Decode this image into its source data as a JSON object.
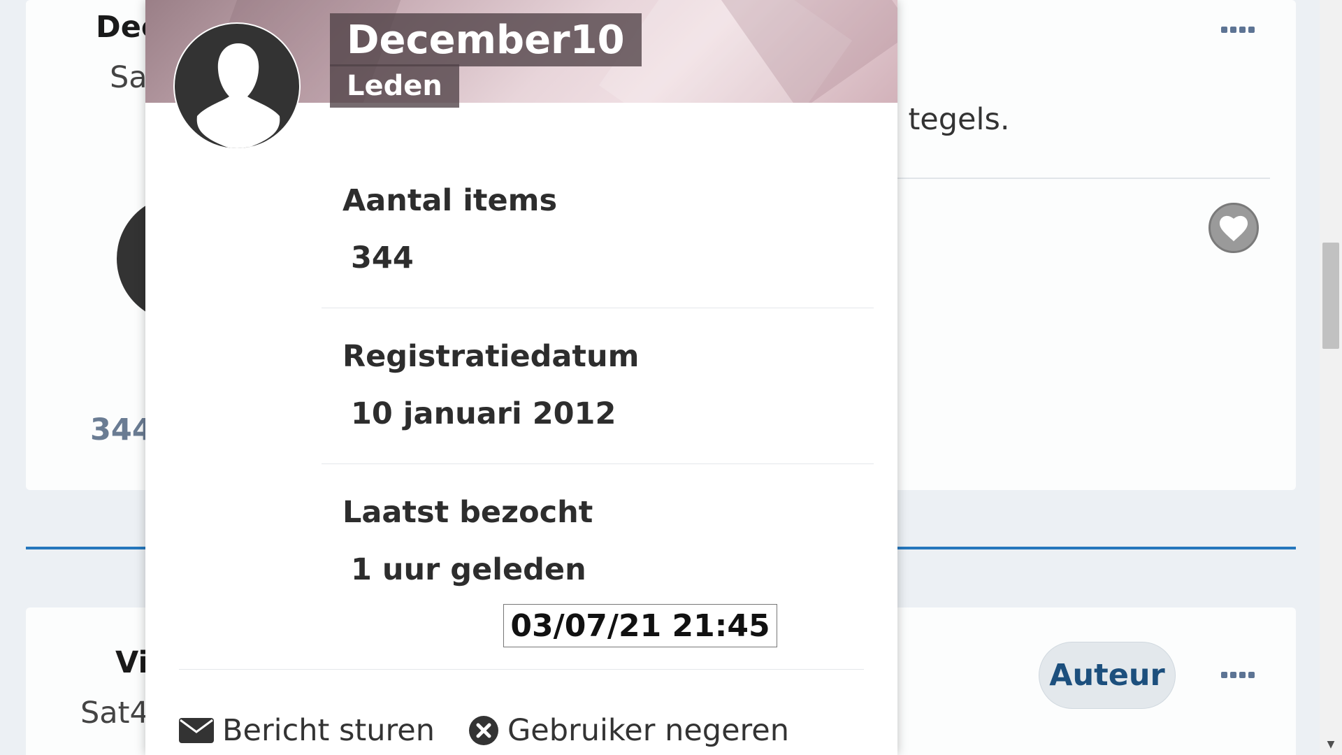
{
  "background_posts": {
    "post1": {
      "author": "Dec",
      "subtitle": "Sa",
      "body_fragment": ") tegels.",
      "count": "344"
    },
    "post2": {
      "author": "Vi",
      "subtitle": "Sat4",
      "badge": "Auteur"
    }
  },
  "member_card": {
    "username": "December10",
    "group": "Leden",
    "stats": [
      {
        "label": "Aantal items",
        "value": "344"
      },
      {
        "label": "Registratiedatum",
        "value": "10 januari 2012"
      },
      {
        "label": "Laatst bezocht",
        "value": "1 uur geleden"
      }
    ],
    "last_visit_tooltip": "03/07/21 21:45",
    "actions": {
      "send_message": "Bericht sturen",
      "ignore_user": "Gebruiker negeren"
    }
  },
  "colors": {
    "accent": "#2577bd",
    "badge_text": "#1c4f7d",
    "count_text": "#6a7c93"
  },
  "icons": [
    "more-icon",
    "heart-icon",
    "envelope-icon",
    "close-circle-icon",
    "user-silhouette-icon"
  ]
}
